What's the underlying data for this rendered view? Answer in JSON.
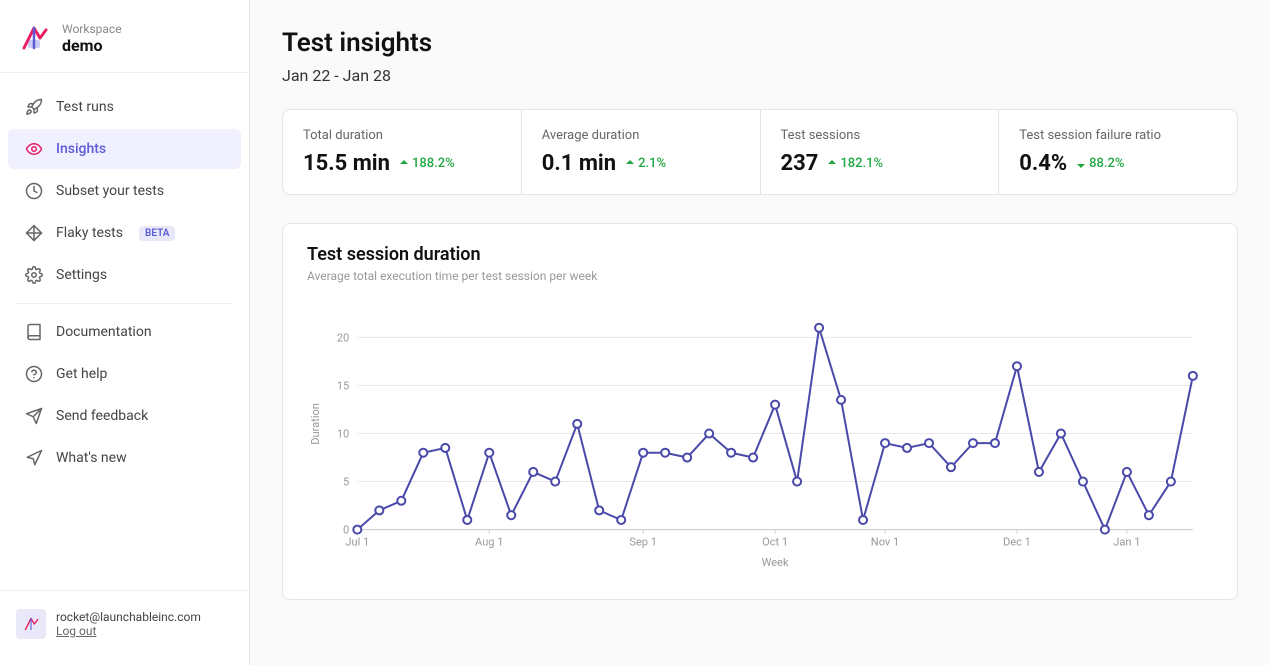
{
  "sidebar": {
    "logo": "launchable-logo",
    "workspace_label": "Workspace",
    "workspace_name": "demo",
    "nav_items": [
      {
        "id": "test-runs",
        "label": "Test runs",
        "icon": "rocket-icon",
        "active": false
      },
      {
        "id": "insights",
        "label": "Insights",
        "icon": "eye-icon",
        "active": true
      },
      {
        "id": "subset-tests",
        "label": "Subset your tests",
        "icon": "clock-icon",
        "active": false
      },
      {
        "id": "flaky-tests",
        "label": "Flaky tests",
        "icon": "snowflake-icon",
        "active": false,
        "badge": "BETA"
      },
      {
        "id": "settings",
        "label": "Settings",
        "icon": "gear-icon",
        "active": false
      }
    ],
    "secondary_items": [
      {
        "id": "documentation",
        "label": "Documentation",
        "icon": "book-icon"
      },
      {
        "id": "get-help",
        "label": "Get help",
        "icon": "circle-question-icon"
      },
      {
        "id": "send-feedback",
        "label": "Send feedback",
        "icon": "paper-plane-icon"
      },
      {
        "id": "whats-new",
        "label": "What's new",
        "icon": "megaphone-icon"
      }
    ],
    "user": {
      "email": "rocket@launchableinc.com",
      "logout_label": "Log out"
    }
  },
  "main": {
    "page_title": "Test insights",
    "date_range": "Jan 22 - Jan 28",
    "metrics": [
      {
        "label": "Total duration",
        "value": "15.5 min",
        "change": "188.2%",
        "direction": "up",
        "color": "up"
      },
      {
        "label": "Average duration",
        "value": "0.1 min",
        "change": "2.1%",
        "direction": "up",
        "color": "up"
      },
      {
        "label": "Test sessions",
        "value": "237",
        "change": "182.1%",
        "direction": "up",
        "color": "up"
      },
      {
        "label": "Test session failure ratio",
        "value": "0.4%",
        "change": "88.2%",
        "direction": "down",
        "color": "down"
      }
    ],
    "chart": {
      "title": "Test session duration",
      "subtitle": "Average total execution time per test session per week",
      "x_label": "Week",
      "y_label": "Duration",
      "x_ticks": [
        "Jul 1",
        "Aug 1",
        "Sep 1",
        "Oct 1",
        "Nov 1",
        "Dec 1",
        "Jan 1"
      ],
      "y_ticks": [
        0,
        5,
        10,
        15,
        20
      ],
      "data_points": [
        {
          "x": 0,
          "y": 0
        },
        {
          "x": 1,
          "y": 2
        },
        {
          "x": 2,
          "y": 3
        },
        {
          "x": 3,
          "y": 8
        },
        {
          "x": 4,
          "y": 8.5
        },
        {
          "x": 5,
          "y": 1
        },
        {
          "x": 6,
          "y": 8
        },
        {
          "x": 7,
          "y": 1.5
        },
        {
          "x": 8,
          "y": 6
        },
        {
          "x": 9,
          "y": 5
        },
        {
          "x": 10,
          "y": 11
        },
        {
          "x": 11,
          "y": 2
        },
        {
          "x": 12,
          "y": 1
        },
        {
          "x": 13,
          "y": 8
        },
        {
          "x": 14,
          "y": 8
        },
        {
          "x": 15,
          "y": 7.5
        },
        {
          "x": 16,
          "y": 10
        },
        {
          "x": 17,
          "y": 8
        },
        {
          "x": 18,
          "y": 7.5
        },
        {
          "x": 19,
          "y": 13
        },
        {
          "x": 20,
          "y": 5
        },
        {
          "x": 21,
          "y": 21
        },
        {
          "x": 22,
          "y": 13.5
        },
        {
          "x": 23,
          "y": 1
        },
        {
          "x": 24,
          "y": 9
        },
        {
          "x": 25,
          "y": 8.5
        },
        {
          "x": 26,
          "y": 9
        },
        {
          "x": 27,
          "y": 6.5
        },
        {
          "x": 28,
          "y": 9
        },
        {
          "x": 29,
          "y": 9
        },
        {
          "x": 30,
          "y": 17
        },
        {
          "x": 31,
          "y": 6
        },
        {
          "x": 32,
          "y": 10
        },
        {
          "x": 33,
          "y": 5
        },
        {
          "x": 34,
          "y": 0
        },
        {
          "x": 35,
          "y": 6
        },
        {
          "x": 36,
          "y": 1.5
        },
        {
          "x": 37,
          "y": 5
        },
        {
          "x": 38,
          "y": 16
        }
      ]
    }
  },
  "colors": {
    "accent": "#5b5bd6",
    "active_bg": "#f0f0ff",
    "up_change": "#22a843",
    "down_good": "#22a843",
    "logo_pink": "#e91e63"
  }
}
